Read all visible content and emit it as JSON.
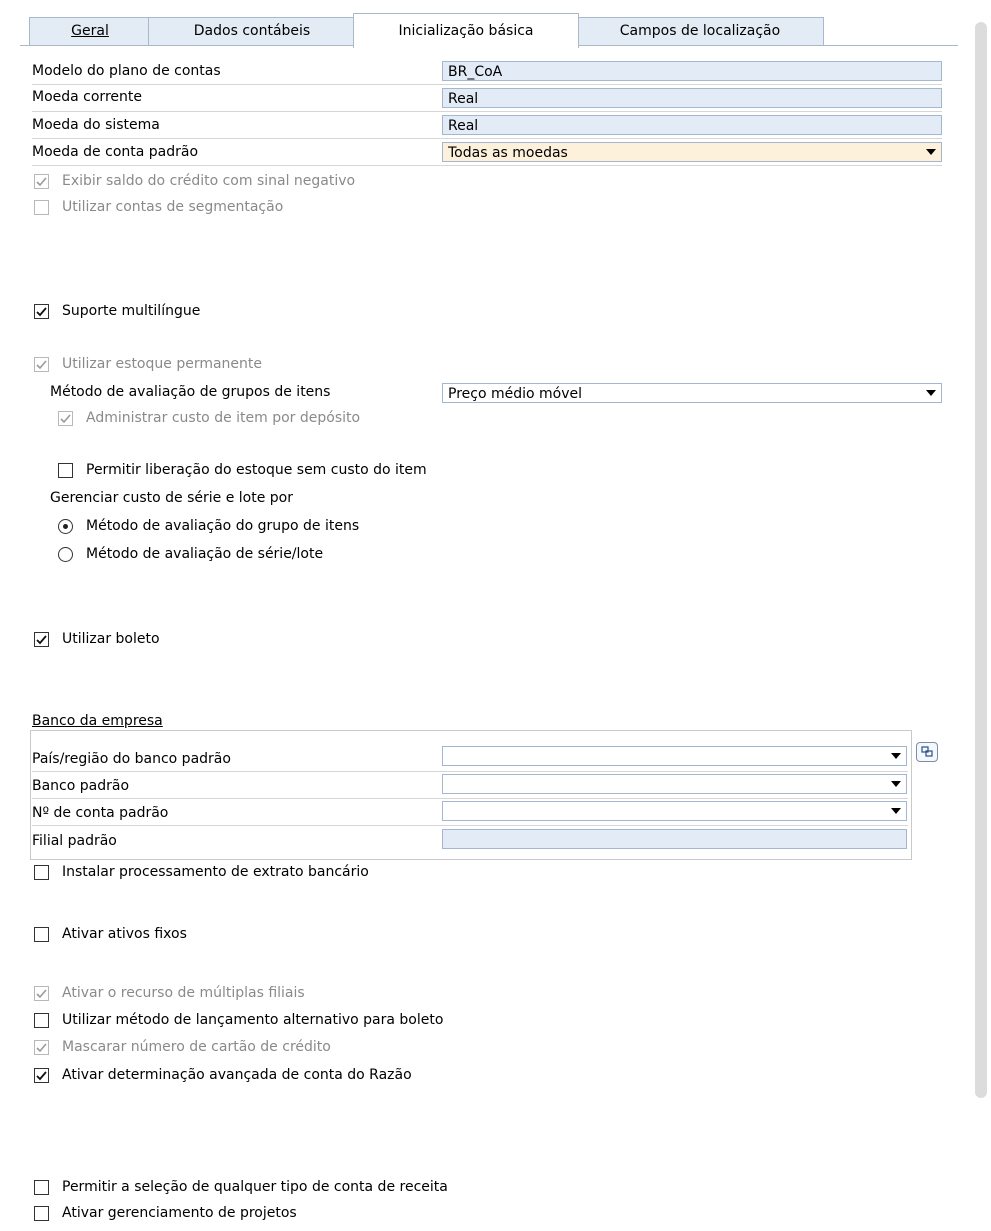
{
  "tabs": [
    {
      "label": "Geral"
    },
    {
      "label": "Dados contábeis"
    },
    {
      "label": "Inicialização básica"
    },
    {
      "label": "Campos de localização"
    }
  ],
  "fields": {
    "chart_template": {
      "label": "Modelo do plano de contas",
      "value": "BR_CoA"
    },
    "local_currency": {
      "label": "Moeda corrente",
      "value": "Real"
    },
    "system_currency": {
      "label": "Moeda do sistema",
      "value": "Real"
    },
    "default_account_currency": {
      "label": "Moeda de conta padrão",
      "value": "Todas as moedas"
    }
  },
  "checks": {
    "credit_negative": {
      "label": "Exibir saldo do crédito com sinal negativo",
      "checked": true,
      "disabled": true
    },
    "segmentation": {
      "label": "Utilizar contas de segmentação",
      "checked": false,
      "disabled": true
    },
    "multilanguage": {
      "label": "Suporte multilíngue",
      "checked": true,
      "disabled": false
    },
    "perpetual_inventory": {
      "label": "Utilizar estoque permanente",
      "checked": true,
      "disabled": true
    },
    "cost_by_warehouse": {
      "label": "Administrar custo de item por depósito",
      "checked": true,
      "disabled": true
    },
    "release_no_cost": {
      "label": "Permitir liberação do estoque sem custo do item",
      "checked": false,
      "disabled": false
    },
    "use_boleto": {
      "label": "Utilizar boleto",
      "checked": true,
      "disabled": false
    },
    "bank_statement": {
      "label": "Instalar processamento de extrato bancário",
      "checked": false,
      "disabled": false
    },
    "fixed_assets": {
      "label": "Ativar ativos fixos",
      "checked": false,
      "disabled": false
    },
    "multiple_branches": {
      "label": "Ativar o recurso de múltiplas filiais",
      "checked": true,
      "disabled": true
    },
    "alt_posting_boleto": {
      "label": "Utilizar método de lançamento alternativo para boleto",
      "checked": false,
      "disabled": false
    },
    "mask_credit_card": {
      "label": "Mascarar número de cartão de crédito",
      "checked": true,
      "disabled": true
    },
    "advanced_gl": {
      "label": "Ativar determinação avançada de conta do Razão",
      "checked": true,
      "disabled": false
    },
    "any_revenue_account": {
      "label": "Permitir a seleção de qualquer tipo de conta de receita",
      "checked": false,
      "disabled": false
    },
    "project_management": {
      "label": "Ativar gerenciamento de projetos",
      "checked": false,
      "disabled": false
    }
  },
  "valuation": {
    "label": "Método de avaliação de grupos de itens",
    "value": "Preço médio móvel"
  },
  "serial_batch": {
    "label": "Gerenciar custo de série e lote por",
    "options": [
      {
        "label": "Método de avaliação do grupo de itens",
        "selected": true
      },
      {
        "label": "Método de avaliação de série/lote",
        "selected": false
      }
    ]
  },
  "bank": {
    "heading": "Banco da empresa",
    "country": {
      "label": "País/região do banco padrão",
      "value": ""
    },
    "default_bank": {
      "label": "Banco padrão",
      "value": ""
    },
    "account_no": {
      "label": "Nº de conta padrão",
      "value": ""
    },
    "branch": {
      "label": "Filial padrão",
      "value": ""
    }
  },
  "icons": {
    "dropdown": "chevron-down-icon",
    "bank_details": "link-icon",
    "check": "checkmark-icon"
  }
}
